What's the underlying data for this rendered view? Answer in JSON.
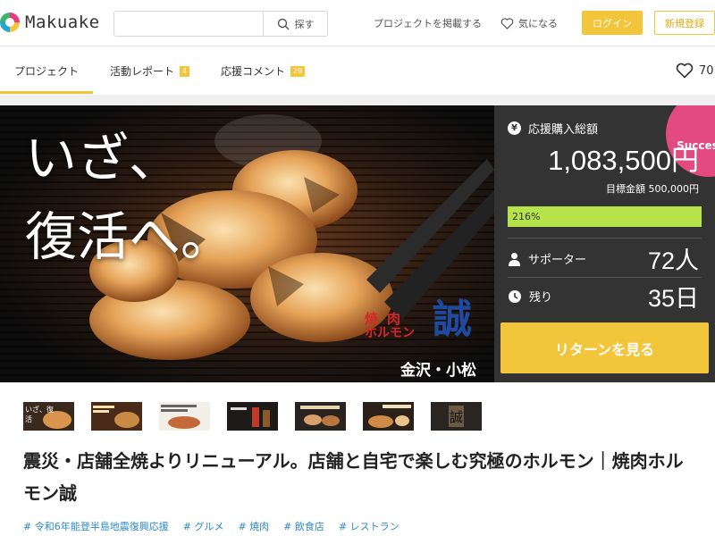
{
  "header": {
    "logo_text": "Makuake",
    "search": {
      "value": "",
      "placeholder": "",
      "button_label": "探す"
    },
    "nav": {
      "post_project": "プロジェクトを掲載する",
      "favorite": "気になる"
    },
    "login_label": "ログイン",
    "signup_label": "新規登録"
  },
  "tabs": [
    {
      "label": "プロジェクト",
      "badge": "",
      "active": true
    },
    {
      "label": "活動レポート",
      "badge": "4"
    },
    {
      "label": "応援コメント",
      "badge": "29"
    }
  ],
  "like_count": "70",
  "hero": {
    "lines": [
      "いざ、",
      "復活へ。"
    ],
    "brand_small": [
      "焼",
      "肉",
      "ホルモン"
    ],
    "brand_kanji": "誠",
    "location": "金沢・小松"
  },
  "panel": {
    "success_label": "Success",
    "total_label": "応援購入総額",
    "total_value": "1,083,500円",
    "goal_label": "目標金額 500,000円",
    "progress_text": "216%",
    "progress_fraction": 1.0,
    "supporters_label": "サポーター",
    "supporters_value": "72人",
    "remaining_label": "残り",
    "remaining_value": "35日",
    "return_button": "リターンを見る"
  },
  "thumbnails": [
    {
      "caption": "いざ、復活"
    },
    {
      "caption": ""
    },
    {
      "caption": ""
    },
    {
      "caption": ""
    },
    {
      "caption": ""
    },
    {
      "caption": ""
    },
    {
      "caption": "誠"
    }
  ],
  "title": "震災・店舗全焼よりリニューアル。店舗と自宅で楽しむ究極のホルモン｜焼肉ホルモン誠",
  "tags": [
    "# 令和6年能登半島地震復興応援",
    "# グルメ",
    "# 焼肉",
    "# 飲食店",
    "# レストラン"
  ],
  "colors": {
    "accent": "#f3c53a",
    "panel_bg": "#333333",
    "success": "#e24a80",
    "progress": "#b6e24a",
    "tag_link": "#2c89c7"
  }
}
